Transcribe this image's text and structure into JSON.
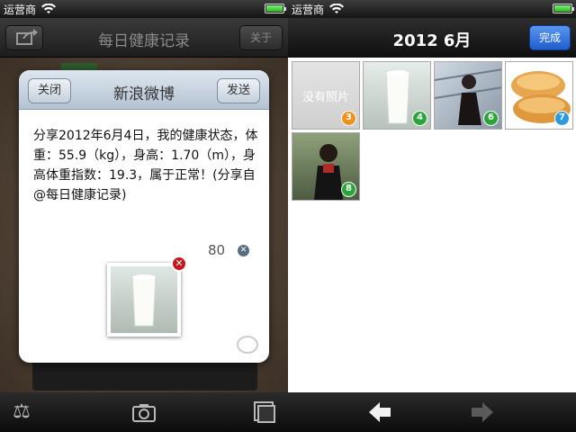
{
  "left": {
    "status": {
      "carrier": "运营商"
    },
    "nav": {
      "title": "每日健康记录",
      "about_label": "关于"
    },
    "dialog": {
      "title": "新浪微博",
      "close_label": "关闭",
      "send_label": "发送",
      "text": "分享2012年6月4日，我的健康状态，体重：55.9（kg），身高：1.70（m），身高体重指数：19.3，属于正常！(分享自 @每日健康记录)",
      "char_count": "80"
    },
    "tabbar": [
      "scale-icon",
      "camera-icon",
      "photos-icon"
    ]
  },
  "right": {
    "status": {
      "carrier": "运营商"
    },
    "nav": {
      "title": "2012 6月",
      "done_label": "完成"
    },
    "tiles": [
      {
        "label": "没有照片",
        "day": "3",
        "badge_color": "#f0901e",
        "icon": "no-photo"
      },
      {
        "label": "",
        "day": "4",
        "badge_color": "#2aa53a",
        "icon": "milk-photo"
      },
      {
        "label": "",
        "day": "6",
        "badge_color": "#2aa53a",
        "icon": "person-photo"
      },
      {
        "label": "",
        "day": "7",
        "badge_color": "#2a9ae0",
        "icon": "bread-photo"
      },
      {
        "label": "",
        "day": "8",
        "badge_color": "#2aa53a",
        "icon": "person-photo"
      }
    ],
    "toolbar": {
      "prev": "left-arrow-icon",
      "next": "right-arrow-icon"
    }
  }
}
